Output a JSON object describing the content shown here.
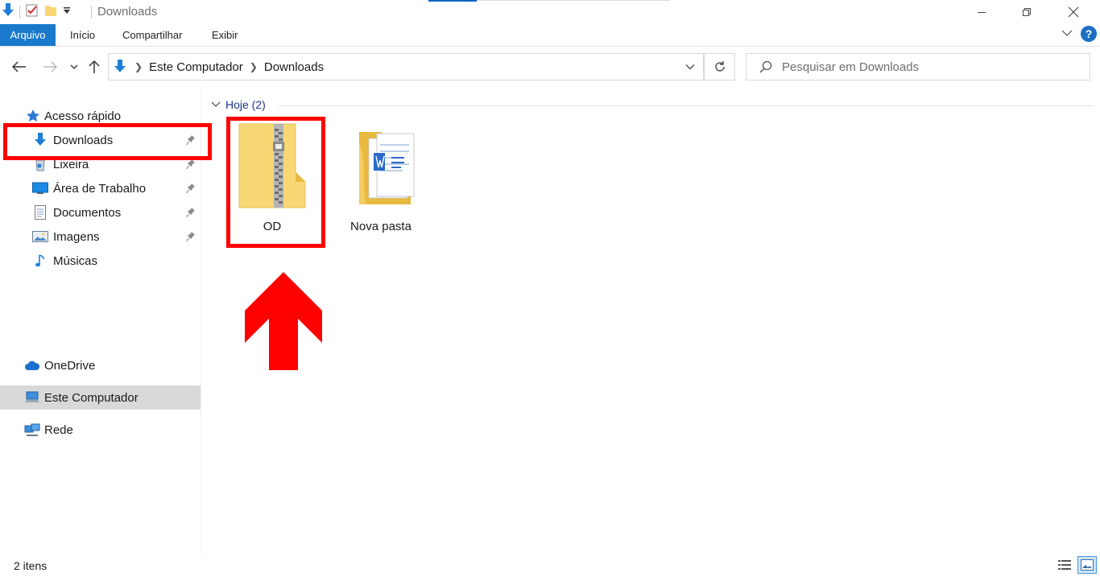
{
  "window": {
    "title": "Downloads"
  },
  "ribbon": {
    "tabs": [
      {
        "label": "Arquivo"
      },
      {
        "label": "Início"
      },
      {
        "label": "Compartilhar"
      },
      {
        "label": "Exibir"
      }
    ],
    "help_label": "?"
  },
  "address": {
    "crumbs": [
      "Este Computador",
      "Downloads"
    ],
    "search_placeholder": "Pesquisar em Downloads"
  },
  "sidebar": {
    "quick_access": "Acesso rápido",
    "pinned": [
      {
        "label": "Downloads",
        "icon": "download-arrow-icon",
        "pinned": true
      },
      {
        "label": "Lixeira",
        "icon": "recycle-bin-icon",
        "pinned": true
      },
      {
        "label": "Área de Trabalho",
        "icon": "desktop-icon",
        "pinned": true
      },
      {
        "label": "Documentos",
        "icon": "documents-icon",
        "pinned": true
      },
      {
        "label": "Imagens",
        "icon": "pictures-icon",
        "pinned": true
      },
      {
        "label": "Músicas",
        "icon": "music-note-icon",
        "pinned": false
      }
    ],
    "onedrive": "OneDrive",
    "this_pc": "Este Computador",
    "network": "Rede"
  },
  "content": {
    "group_header": "Hoje (2)",
    "items": [
      {
        "name": "OD",
        "type": "zip-folder-icon"
      },
      {
        "name": "Nova pasta",
        "type": "folder-with-documents-icon"
      }
    ]
  },
  "statusbar": {
    "count": "2 itens"
  },
  "colors": {
    "accent": "#1979ca",
    "highlight": "#ff0000",
    "folder": "#f8d775"
  }
}
